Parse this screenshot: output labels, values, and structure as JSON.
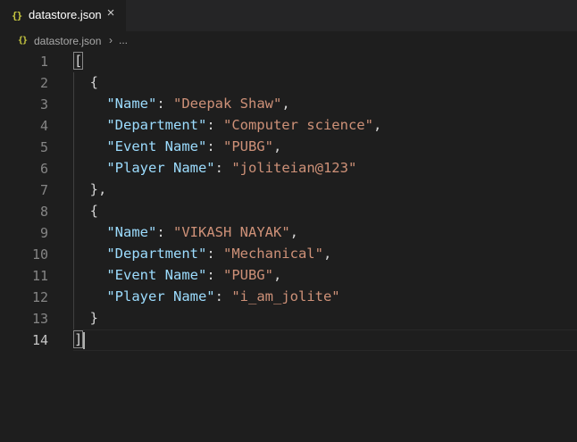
{
  "tab": {
    "icon": "{}",
    "filename": "datastore.json",
    "close_glyph": "×"
  },
  "breadcrumb": {
    "icon": "{}",
    "filename": "datastore.json",
    "separator": "›",
    "more": "..."
  },
  "editor": {
    "line_numbers": [
      "1",
      "2",
      "3",
      "4",
      "5",
      "6",
      "7",
      "8",
      "9",
      "10",
      "11",
      "12",
      "13",
      "14"
    ],
    "active_line": "14",
    "lines": [
      [
        {
          "t": "punc",
          "v": "["
        }
      ],
      [
        {
          "t": "punc",
          "v": "  {"
        }
      ],
      [
        {
          "t": "punc",
          "v": "    "
        },
        {
          "t": "key",
          "v": "\"Name\""
        },
        {
          "t": "punc",
          "v": ": "
        },
        {
          "t": "str",
          "v": "\"Deepak Shaw\""
        },
        {
          "t": "punc",
          "v": ","
        }
      ],
      [
        {
          "t": "punc",
          "v": "    "
        },
        {
          "t": "key",
          "v": "\"Department\""
        },
        {
          "t": "punc",
          "v": ": "
        },
        {
          "t": "str",
          "v": "\"Computer science\""
        },
        {
          "t": "punc",
          "v": ","
        }
      ],
      [
        {
          "t": "punc",
          "v": "    "
        },
        {
          "t": "key",
          "v": "\"Event Name\""
        },
        {
          "t": "punc",
          "v": ": "
        },
        {
          "t": "str",
          "v": "\"PUBG\""
        },
        {
          "t": "punc",
          "v": ","
        }
      ],
      [
        {
          "t": "punc",
          "v": "    "
        },
        {
          "t": "key",
          "v": "\"Player Name\""
        },
        {
          "t": "punc",
          "v": ": "
        },
        {
          "t": "str",
          "v": "\"joliteian@123\""
        }
      ],
      [
        {
          "t": "punc",
          "v": "  },"
        }
      ],
      [
        {
          "t": "punc",
          "v": "  {"
        }
      ],
      [
        {
          "t": "punc",
          "v": "    "
        },
        {
          "t": "key",
          "v": "\"Name\""
        },
        {
          "t": "punc",
          "v": ": "
        },
        {
          "t": "str",
          "v": "\"VIKASH NAYAK\""
        },
        {
          "t": "punc",
          "v": ","
        }
      ],
      [
        {
          "t": "punc",
          "v": "    "
        },
        {
          "t": "key",
          "v": "\"Department\""
        },
        {
          "t": "punc",
          "v": ": "
        },
        {
          "t": "str",
          "v": "\"Mechanical\""
        },
        {
          "t": "punc",
          "v": ","
        }
      ],
      [
        {
          "t": "punc",
          "v": "    "
        },
        {
          "t": "key",
          "v": "\"Event Name\""
        },
        {
          "t": "punc",
          "v": ": "
        },
        {
          "t": "str",
          "v": "\"PUBG\""
        },
        {
          "t": "punc",
          "v": ","
        }
      ],
      [
        {
          "t": "punc",
          "v": "    "
        },
        {
          "t": "key",
          "v": "\"Player Name\""
        },
        {
          "t": "punc",
          "v": ": "
        },
        {
          "t": "str",
          "v": "\"i_am_jolite\""
        }
      ],
      [
        {
          "t": "punc",
          "v": "  }"
        }
      ],
      [
        {
          "t": "punc",
          "v": "]"
        }
      ]
    ]
  },
  "colors": {
    "background": "#1e1e1e",
    "tabbar": "#252526",
    "key": "#9cdcfe",
    "string": "#ce9178",
    "punctuation": "#d4d4d4",
    "line_number": "#858585",
    "json_icon": "#cbcb41"
  }
}
